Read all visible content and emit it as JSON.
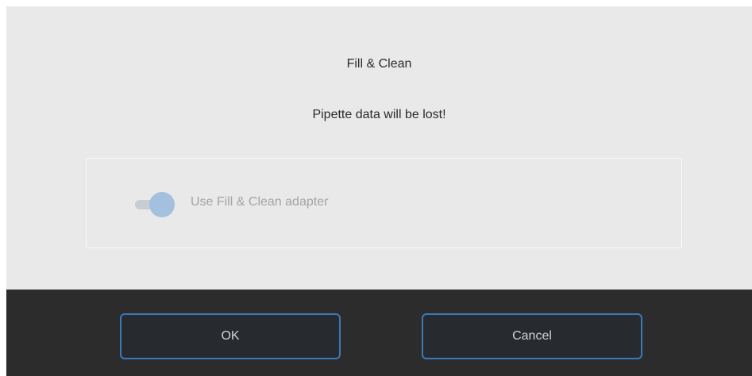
{
  "dialog": {
    "title": "Fill & Clean",
    "message": "Pipette data will be lost!",
    "option": {
      "label": "Use Fill & Clean adapter",
      "enabled": true,
      "disabled": true
    },
    "buttons": {
      "ok_label": "OK",
      "cancel_label": "Cancel"
    }
  },
  "colors": {
    "dialog_background": "#e9e9e9",
    "footer_background": "#2c2c2c",
    "button_border": "#3b79b8",
    "button_text": "#d3d3d3",
    "toggle_knob": "#a3c0de",
    "toggle_track": "#c8cdd3",
    "disabled_text": "#a4a4a4"
  }
}
